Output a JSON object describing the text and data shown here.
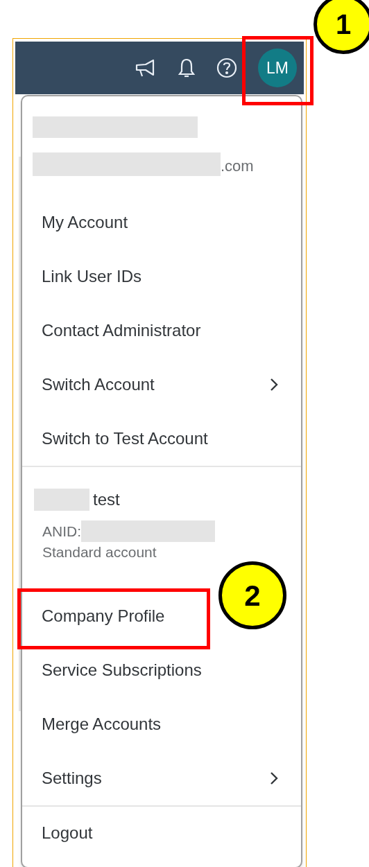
{
  "header": {
    "avatar": {
      "initials": "LM"
    }
  },
  "menu": {
    "email_suffix": ".com",
    "items": [
      {
        "label": "My Account",
        "submenu": false
      },
      {
        "label": "Link User IDs",
        "submenu": false
      },
      {
        "label": "Contact Administrator",
        "submenu": false
      },
      {
        "label": "Switch Account",
        "submenu": true
      },
      {
        "label": "Switch to Test Account",
        "submenu": false
      }
    ],
    "account": {
      "name_suffix": "test",
      "anid_label": "ANID:",
      "type": "Standard account"
    },
    "account_items": [
      {
        "label": "Company Profile",
        "submenu": false
      },
      {
        "label": "Service Subscriptions",
        "submenu": false
      },
      {
        "label": "Merge Accounts",
        "submenu": false
      },
      {
        "label": "Settings",
        "submenu": true
      }
    ],
    "logout": "Logout"
  },
  "callouts": [
    {
      "number": "1"
    },
    {
      "number": "2"
    }
  ]
}
